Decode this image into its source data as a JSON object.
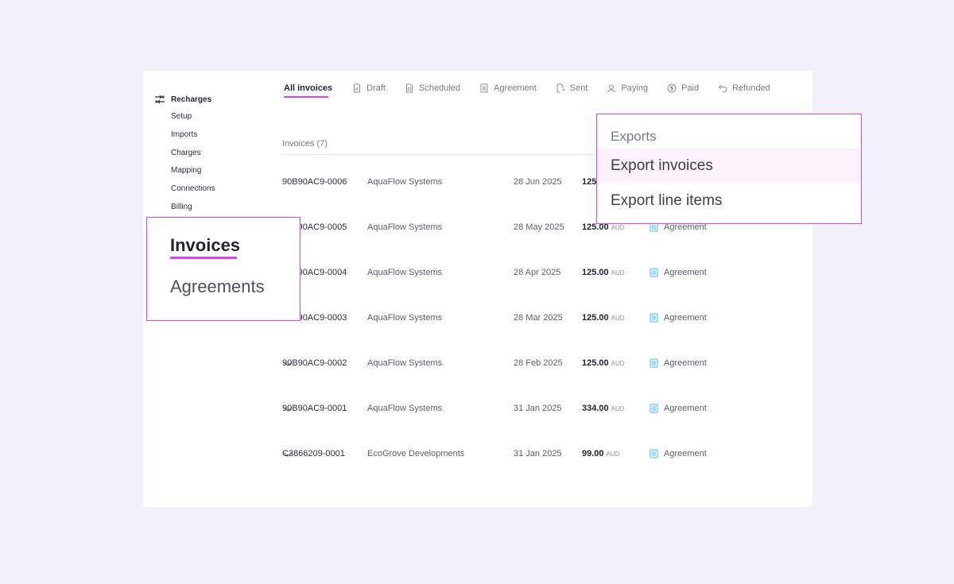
{
  "sidebar": {
    "heading": "Recharges",
    "items": [
      "Setup",
      "Imports",
      "Charges",
      "Mapping",
      "Connections",
      "Billing"
    ]
  },
  "tabs": [
    {
      "label": "All invoices",
      "icon": "none"
    },
    {
      "label": "Draft",
      "icon": "document-icon"
    },
    {
      "label": "Scheduled",
      "icon": "scheduled-document-icon"
    },
    {
      "label": "Agreement",
      "icon": "agreement-icon"
    },
    {
      "label": "Sent",
      "icon": "sent-icon"
    },
    {
      "label": "Paying",
      "icon": "user-icon"
    },
    {
      "label": "Paid",
      "icon": "dollar-circle-icon"
    },
    {
      "label": "Refunded",
      "icon": "undo-icon"
    }
  ],
  "list": {
    "count_label": "Invoices (7)",
    "currency": "AUD",
    "rows": [
      {
        "id": "90B90AC9-0006",
        "name": "AquaFlow Systems",
        "date": "28 Jun 2025",
        "amount": "125",
        "type": ""
      },
      {
        "id": "90B90AC9-0005",
        "name": "AquaFlow Systems",
        "date": "28 May 2025",
        "amount": "125.00",
        "type": "Agreement"
      },
      {
        "id": "90B90AC9-0004",
        "name": "AquaFlow Systems",
        "date": "28 Apr 2025",
        "amount": "125.00",
        "type": "Agreement"
      },
      {
        "id": "90B90AC9-0003",
        "name": "AquaFlow Systems",
        "date": "28 Mar 2025",
        "amount": "125.00",
        "type": "Agreement"
      },
      {
        "id": "90B90AC9-0002",
        "name": "AquaFlow Systems",
        "date": "28 Feb 2025",
        "amount": "125.00",
        "type": "Agreement"
      },
      {
        "id": "90B90AC9-0001",
        "name": "AquaFlow Systems",
        "date": "31 Jan 2025",
        "amount": "334.00",
        "type": "Agreement"
      },
      {
        "id": "C3866209-0001",
        "name": "EcoGrove Developments",
        "date": "31 Jan 2025",
        "amount": "99.00",
        "type": "Agreement"
      }
    ]
  },
  "callout_nav": {
    "active": "Invoices",
    "other": "Agreements"
  },
  "exports_menu": {
    "heading": "Exports",
    "options": [
      "Export invoices",
      "Export line items"
    ]
  },
  "colors": {
    "accent": "#d946ef",
    "background": "#f2f0fb",
    "agreement_icon": "#38bdf8"
  }
}
